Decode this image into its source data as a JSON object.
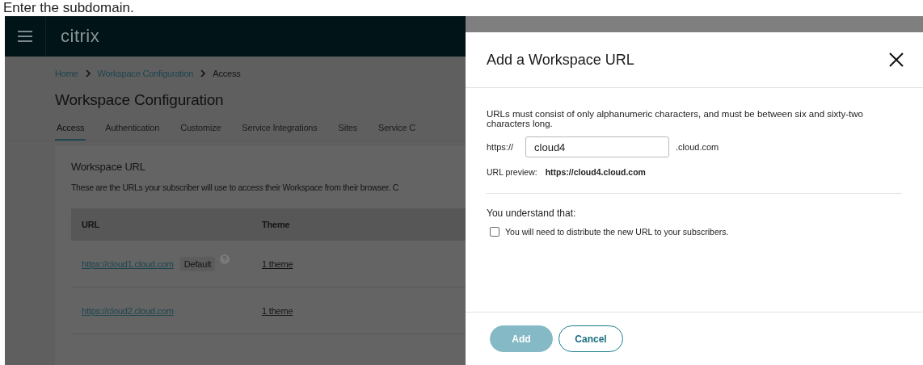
{
  "caption": "Enter the subdomain.",
  "header": {
    "logo": "citrix"
  },
  "breadcrumb": [
    {
      "label": "Home",
      "link": true
    },
    {
      "label": "Workspace Configuration",
      "link": true
    },
    {
      "label": "Access",
      "link": false
    }
  ],
  "page_title": "Workspace Configuration",
  "tabs": [
    {
      "label": "Access",
      "selected": true
    },
    {
      "label": "Authentication",
      "selected": false
    },
    {
      "label": "Customize",
      "selected": false
    },
    {
      "label": "Service Integrations",
      "selected": false
    },
    {
      "label": "Sites",
      "selected": false
    },
    {
      "label": "Service C",
      "selected": false
    }
  ],
  "card": {
    "title": "Workspace URL",
    "description": "These are the URLs your subscriber will use to access their Workspace from their browser. C",
    "table": {
      "columns": [
        "URL",
        "Theme"
      ],
      "rows": [
        {
          "url": "https://cloud1.cloud.com",
          "badge": "Default",
          "theme": "1 theme"
        },
        {
          "url": "https://cloud2.cloud.com",
          "theme": "1 theme"
        }
      ]
    }
  },
  "drawer": {
    "title": "Add a Workspace URL",
    "instructions": "URLs must consist of only alphanumeric characters, and must be between six and sixty-two characters long.",
    "prefix": "https://",
    "field": {
      "value": "cloud4"
    },
    "suffix": ".cloud.com",
    "preview_label": "URL preview:",
    "preview_value": "https://cloud4.cloud.com",
    "acknowledge_heading": "You understand that:",
    "acknowledgements": [
      {
        "label": "You will need to distribute the new URL to your subscribers.",
        "checked": false
      }
    ],
    "buttons": [
      {
        "label": "Add",
        "kind": "primary",
        "disabled": true
      },
      {
        "label": "Cancel",
        "kind": "secondary",
        "disabled": false
      }
    ]
  }
}
